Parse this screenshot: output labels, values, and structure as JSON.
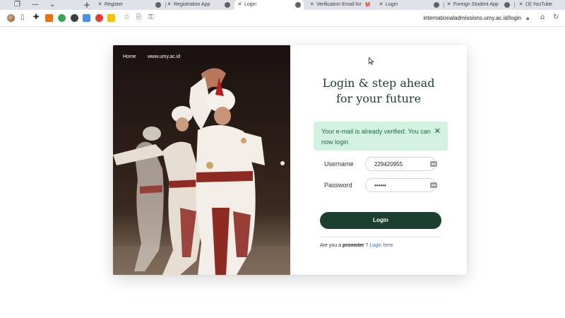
{
  "browser": {
    "tabs": [
      {
        "title": "Register",
        "icon": "globe-icon"
      },
      {
        "title": "Registration App",
        "icon": "globe-icon"
      },
      {
        "title": "Login",
        "icon": "globe-icon",
        "active": true
      },
      {
        "title": "Verification Email for",
        "icon": "gmail-icon"
      },
      {
        "title": "Login",
        "icon": "globe-icon"
      },
      {
        "title": "Foreign Student App",
        "icon": "globe-icon"
      },
      {
        "title": "(3) YouTube",
        "icon": "youtube-icon"
      }
    ],
    "new_tab": "+",
    "url": "internationaladmissions.umy.ac.id/login"
  },
  "hero": {
    "nav": [
      "Home",
      "www.umy.ac.id"
    ]
  },
  "login": {
    "headline_line1": "Login & step ahead",
    "headline_line2": "for your future",
    "alert_text": "Your e-mail is already verified. You can now login",
    "alert_close": "✕",
    "username_label": "Username",
    "username_value": "229420955",
    "password_label": "Password",
    "password_value": "••••••",
    "submit_label": "Login",
    "promoter_prefix": "Are you a",
    "promoter_bold": "promoter",
    "promoter_q": "?",
    "promoter_link": "Login here"
  },
  "colors": {
    "brand_green": "#1c4030",
    "alert_bg": "#d3f1e1",
    "alert_text": "#1f6b45",
    "headline": "#1b3d2c"
  }
}
